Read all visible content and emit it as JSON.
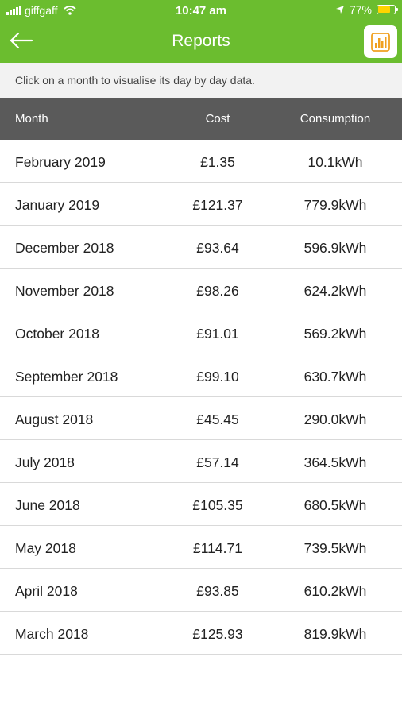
{
  "status": {
    "carrier": "giffgaff",
    "time": "10:47 am",
    "battery": "77%",
    "battery_level": 0.77,
    "accent": "#ffd400"
  },
  "header": {
    "title": "Reports",
    "back_icon": "back-arrow-icon",
    "report_icon": "bar-chart-icon",
    "brand_color": "#6bbd2f"
  },
  "hint": "Click on a month to visualise its day by day data.",
  "table": {
    "headers": {
      "month": "Month",
      "cost": "Cost",
      "consumption": "Consumption"
    },
    "rows": [
      {
        "month": "February 2019",
        "cost": "£1.35",
        "consumption": "10.1kWh"
      },
      {
        "month": "January 2019",
        "cost": "£121.37",
        "consumption": "779.9kWh"
      },
      {
        "month": "December 2018",
        "cost": "£93.64",
        "consumption": "596.9kWh"
      },
      {
        "month": "November 2018",
        "cost": "£98.26",
        "consumption": "624.2kWh"
      },
      {
        "month": "October 2018",
        "cost": "£91.01",
        "consumption": "569.2kWh"
      },
      {
        "month": "September 2018",
        "cost": "£99.10",
        "consumption": "630.7kWh"
      },
      {
        "month": "August 2018",
        "cost": "£45.45",
        "consumption": "290.0kWh"
      },
      {
        "month": "July 2018",
        "cost": "£57.14",
        "consumption": "364.5kWh"
      },
      {
        "month": "June 2018",
        "cost": "£105.35",
        "consumption": "680.5kWh"
      },
      {
        "month": "May 2018",
        "cost": "£114.71",
        "consumption": "739.5kWh"
      },
      {
        "month": "April 2018",
        "cost": "£93.85",
        "consumption": "610.2kWh"
      },
      {
        "month": "March 2018",
        "cost": "£125.93",
        "consumption": "819.9kWh"
      }
    ]
  }
}
